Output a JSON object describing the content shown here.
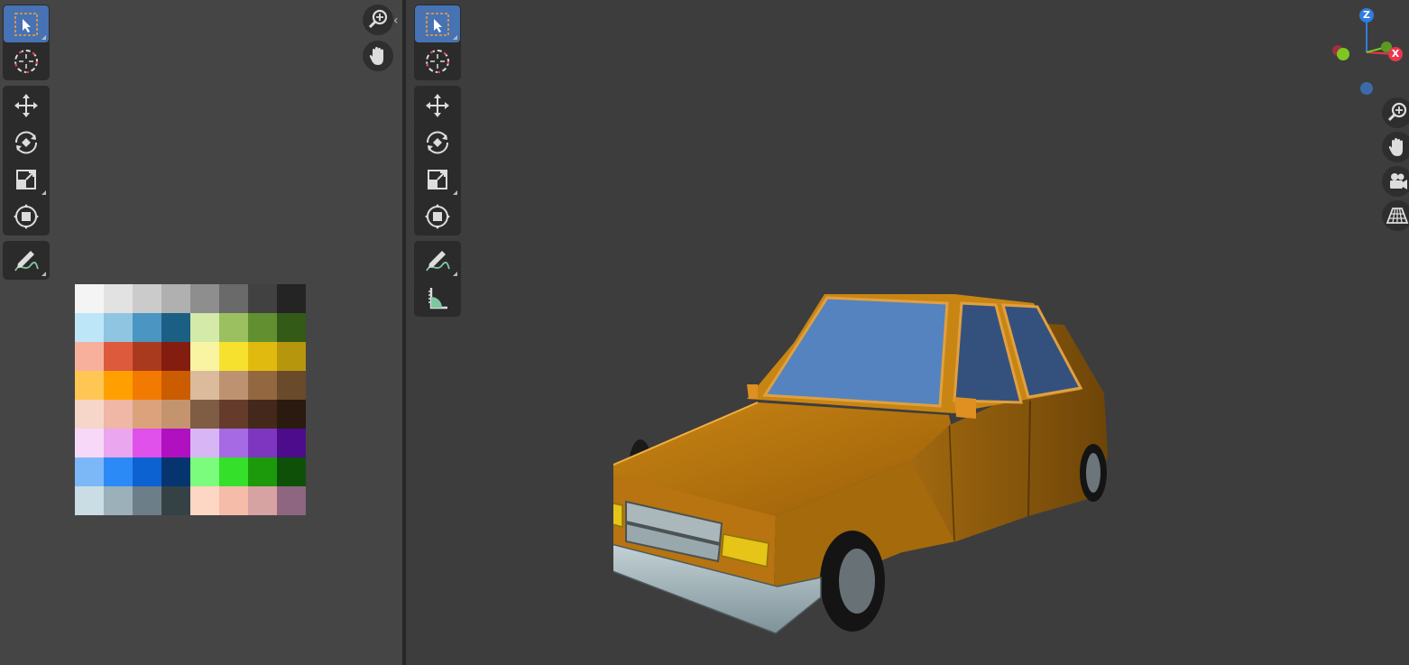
{
  "uv_editor": {
    "tools": [
      {
        "name": "select-box-tool",
        "icon": "select-box-icon",
        "active": true
      },
      {
        "name": "cursor-tool",
        "icon": "cursor-icon",
        "active": false
      },
      {
        "name": "move-tool",
        "icon": "move-icon",
        "active": false
      },
      {
        "name": "rotate-tool",
        "icon": "rotate-icon",
        "active": false
      },
      {
        "name": "scale-tool",
        "icon": "scale-icon",
        "active": false
      },
      {
        "name": "transform-tool",
        "icon": "transform-icon",
        "active": false
      },
      {
        "name": "annotate-tool",
        "icon": "annotate-icon",
        "active": false
      }
    ],
    "nav": [
      "zoom-icon",
      "pan-hand-icon"
    ],
    "collapse_glyph": "‹",
    "palette": [
      [
        "#f4f4f4",
        "#e2e2e2",
        "#cbcbcb",
        "#b0b0b0",
        "#8e8e8e",
        "#6a6a6a",
        "#414141",
        "#242424"
      ],
      [
        "#bde6f8",
        "#8fc5e0",
        "#4a95c2",
        "#1c5f84",
        "#d4eaa8",
        "#9bc060",
        "#629030",
        "#335a16"
      ],
      [
        "#f7b09c",
        "#dd5a3c",
        "#aa3a1e",
        "#831d10",
        "#f8f4a2",
        "#f6e22e",
        "#e1ba10",
        "#b6960c"
      ],
      [
        "#ffc654",
        "#ffa000",
        "#f27a00",
        "#cc5c00",
        "#dbbb9c",
        "#bd9270",
        "#93673f",
        "#694a2a"
      ],
      [
        "#f6d6c8",
        "#f0b6a6",
        "#dba27c",
        "#c4946e",
        "#7f5c44",
        "#653c2c",
        "#44281c",
        "#2a1a10"
      ],
      [
        "#f8d8f8",
        "#eaa6ee",
        "#e050ea",
        "#b010c0",
        "#d8b6f6",
        "#a66ae4",
        "#7e36c0",
        "#4c0c8c"
      ],
      [
        "#7cb8f8",
        "#2c8af6",
        "#0c62d0",
        "#06346e",
        "#7cfc7c",
        "#34e02a",
        "#1c9a0c",
        "#0e5008"
      ],
      [
        "#cadce4",
        "#9cb0ba",
        "#6c7e88",
        "#344246",
        "#fed6c4",
        "#f6bcaa",
        "#d6a2a2",
        "#8e6682"
      ]
    ]
  },
  "viewport": {
    "tools": [
      {
        "name": "select-box-tool",
        "icon": "select-box-icon",
        "active": true
      },
      {
        "name": "cursor-tool",
        "icon": "cursor-icon",
        "active": false
      },
      {
        "name": "move-tool",
        "icon": "move-icon",
        "active": false
      },
      {
        "name": "rotate-tool",
        "icon": "rotate-icon",
        "active": false
      },
      {
        "name": "scale-tool",
        "icon": "scale-icon",
        "active": false
      },
      {
        "name": "transform-tool",
        "icon": "transform-icon",
        "active": false
      },
      {
        "name": "annotate-tool",
        "icon": "annotate-icon",
        "active": false
      },
      {
        "name": "measure-tool",
        "icon": "measure-icon",
        "active": false
      }
    ],
    "nav": [
      "zoom-icon",
      "pan-hand-icon",
      "camera-icon",
      "perspective-grid-icon"
    ],
    "gizmo": {
      "z": "Z",
      "x": "X",
      "colors": {
        "z": "#2f7de1",
        "x": "#e8374d",
        "y": "#7cc820",
        "neg": "#3a6aa8"
      }
    },
    "object": {
      "name": "low-poly car",
      "body_color": "#c07a12",
      "window_color": "#5483bf"
    }
  }
}
